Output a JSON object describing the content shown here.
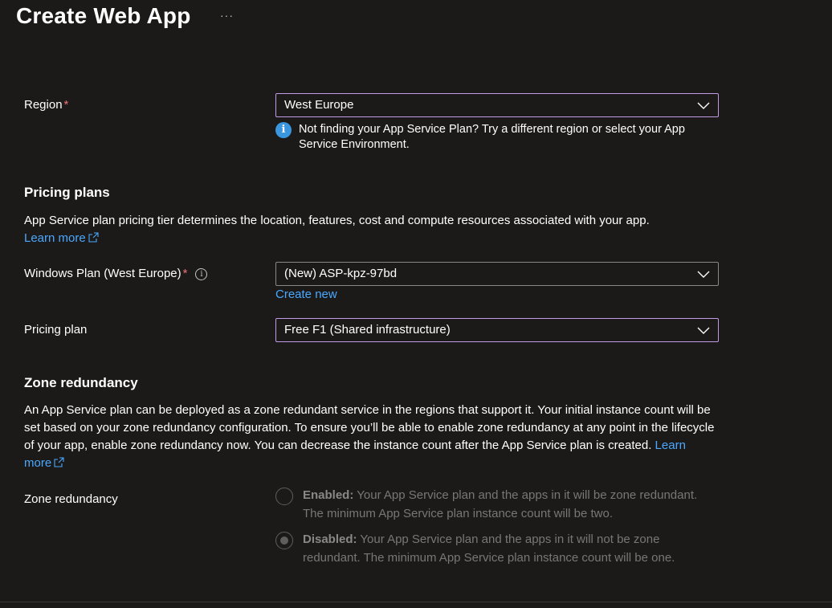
{
  "header": {
    "title": "Create Web App",
    "more_label": "···"
  },
  "region": {
    "label": "Region",
    "required_mark": "*",
    "value": "West Europe",
    "notice": "Not finding your App Service Plan? Try a different region or select your App Service Environment."
  },
  "pricing": {
    "section_title": "Pricing plans",
    "description": "App Service plan pricing tier determines the location, features, cost and compute resources associated with your app.",
    "learn_more": "Learn more",
    "windows_plan": {
      "label": "Windows Plan (West Europe)",
      "required_mark": "*",
      "info_glyph": "i",
      "value": "(New) ASP-kpz-97bd",
      "create_new": "Create new"
    },
    "pricing_plan": {
      "label": "Pricing plan",
      "value": "Free F1 (Shared infrastructure)"
    }
  },
  "zone": {
    "section_title": "Zone redundancy",
    "description": "An App Service plan can be deployed as a zone redundant service in the regions that support it. Your initial instance count will be set based on your zone redundancy configuration. To ensure you’ll be able to enable zone redundancy at any point in the lifecycle of your app, enable zone redundancy now. You can decrease the instance count after the App Service plan is created.",
    "learn_more": "Learn more",
    "field_label": "Zone redundancy",
    "options": [
      {
        "title": "Enabled:",
        "text": "Your App Service plan and the apps in it will be zone redundant. The minimum App Service plan instance count will be two.",
        "checked": false
      },
      {
        "title": "Disabled:",
        "text": "Your App Service plan and the apps in it will not be zone redundant. The minimum App Service plan instance count will be one.",
        "checked": true
      }
    ]
  },
  "colors": {
    "background": "#1b1a19",
    "focus_border": "#c29be6",
    "link": "#4aa8ff",
    "required": "#f1707b",
    "info_blue": "#3a96dd"
  },
  "icons": {
    "more": "ellipsis-icon",
    "chevron": "chevron-down-icon",
    "info": "info-icon",
    "external": "external-link-icon"
  }
}
